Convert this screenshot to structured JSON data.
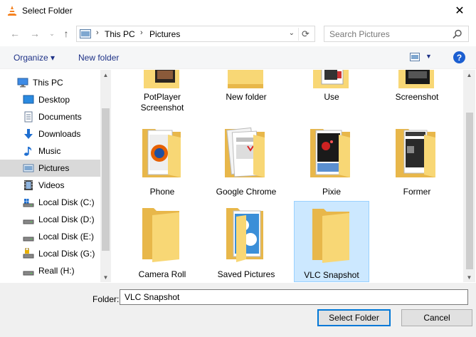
{
  "window": {
    "title": "Select Folder"
  },
  "nav": {
    "breadcrumbs": [
      "This PC",
      "Pictures"
    ],
    "search_placeholder": "Search Pictures"
  },
  "toolbar": {
    "organize": "Organize ▾",
    "new_folder": "New folder"
  },
  "sidebar": {
    "items": [
      {
        "label": "This PC",
        "icon": "computer-icon"
      },
      {
        "label": "Desktop",
        "icon": "desktop-icon"
      },
      {
        "label": "Documents",
        "icon": "documents-icon"
      },
      {
        "label": "Downloads",
        "icon": "downloads-icon"
      },
      {
        "label": "Music",
        "icon": "music-icon"
      },
      {
        "label": "Pictures",
        "icon": "pictures-icon",
        "selected": true
      },
      {
        "label": "Videos",
        "icon": "videos-icon"
      },
      {
        "label": "Local Disk (C:)",
        "icon": "drive-icon"
      },
      {
        "label": "Local Disk (D:)",
        "icon": "drive-icon"
      },
      {
        "label": "Local Disk (E:)",
        "icon": "drive-icon"
      },
      {
        "label": "Local Disk (G:)",
        "icon": "locked-drive-icon"
      },
      {
        "label": "Reall (H:)",
        "icon": "drive-icon"
      }
    ]
  },
  "folders": {
    "row1": [
      "PotPlayer Screenshot",
      "New folder",
      "Use",
      "Screenshot"
    ],
    "row2": [
      "Phone",
      "Google Chrome",
      "Pixie",
      "Former"
    ],
    "row3": [
      "Camera Roll",
      "Saved Pictures",
      "VLC Snapshot"
    ]
  },
  "footer": {
    "folder_label": "Folder:",
    "folder_value": "VLC Snapshot",
    "select_button": "Select Folder",
    "cancel_button": "Cancel"
  },
  "colors": {
    "folder": "#f8d775",
    "folder_dark": "#e8b74a",
    "selection": "#cce8ff",
    "link": "#1e3287",
    "accent": "#0078d7"
  }
}
